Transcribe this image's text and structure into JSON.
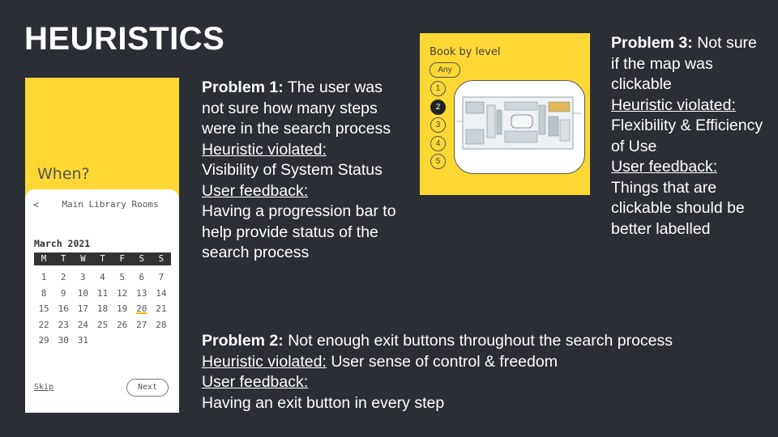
{
  "title": "HEURISTICS",
  "problem1": {
    "label": "Problem 1:",
    "text": " The user was not sure how many steps were in the search process",
    "heuristic_label": "Heuristic violated:",
    "heuristic": "Visibility of System Status",
    "feedback_label": "User feedback:",
    "feedback": "Having a progression bar to help provide status of the search process"
  },
  "problem2": {
    "label": "Problem 2:",
    "text": " Not enough exit buttons throughout the search process",
    "heuristic_label": "Heuristic violated:",
    "heuristic": " User sense of control & freedom",
    "feedback_label": "User feedback:",
    "feedback": "Having an exit button in every step"
  },
  "problem3": {
    "label": "Problem 3:",
    "text": " Not sure if the map was clickable",
    "heuristic_label": "Heuristic violated:",
    "heuristic": "Flexibility & Efficiency of Use",
    "feedback_label": "User feedback:",
    "feedback": "Things that are clickable should be better labelled"
  },
  "phone": {
    "heading": "When?",
    "back": "<",
    "location": "Main Library Rooms",
    "month": "March 2021",
    "weekdays": [
      "M",
      "T",
      "W",
      "T",
      "F",
      "S",
      "S"
    ],
    "weeks": [
      [
        "1",
        "2",
        "3",
        "4",
        "5",
        "6",
        "7"
      ],
      [
        "8",
        "9",
        "10",
        "11",
        "12",
        "13",
        "14"
      ],
      [
        "15",
        "16",
        "17",
        "18",
        "19",
        "20",
        "21"
      ],
      [
        "22",
        "23",
        "24",
        "25",
        "26",
        "27",
        "28"
      ],
      [
        "29",
        "30",
        "31",
        "",
        "",
        "",
        ""
      ]
    ],
    "selected_day": "20",
    "skip": "Skip",
    "next": "Next"
  },
  "map": {
    "heading": "Book by level",
    "any": "Any",
    "levels": [
      "1",
      "2",
      "3",
      "4",
      "5"
    ],
    "active_level": "2"
  },
  "colors": {
    "background": "#2b2e35",
    "accent_yellow": "#fdd835"
  }
}
